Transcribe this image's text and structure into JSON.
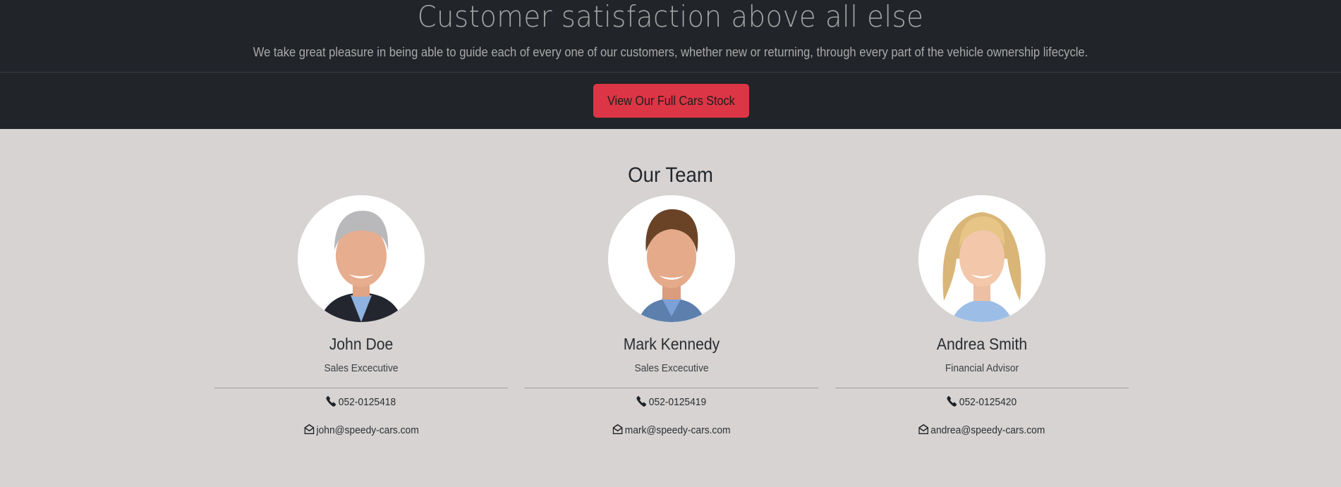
{
  "hero": {
    "title": "Customer satisfaction above all else",
    "subtitle": "We take great pleasure in being able to guide each of every one of our customers, whether new or returning, through every part of the vehicle ownership lifecycle.",
    "cta_label": "View Our Full Cars Stock"
  },
  "team": {
    "title": "Our Team",
    "members": [
      {
        "name": "John Doe",
        "role": "Sales Excecutive",
        "phone": "052-0125418",
        "email": "john@speedy-cars.com"
      },
      {
        "name": "Mark Kennedy",
        "role": "Sales Excecutive",
        "phone": "052-0125419",
        "email": "mark@speedy-cars.com"
      },
      {
        "name": "Andrea Smith",
        "role": "Financial Advisor",
        "phone": "052-0125420",
        "email": "andrea@speedy-cars.com"
      }
    ]
  },
  "icons": {
    "phone": "phone-icon",
    "email": "envelope-open-icon"
  },
  "colors": {
    "hero_background": "#212429",
    "section_background": "#d6d3d2",
    "accent_button": "#dc3545"
  }
}
